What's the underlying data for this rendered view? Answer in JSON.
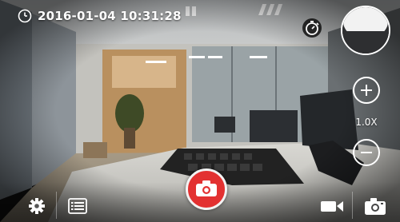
{
  "camera": {
    "timestamp": "2016-01-04 10:31:28",
    "zoom_level": "1.0X"
  },
  "controls": {
    "timer_icon": "self-timer-icon",
    "preview_icon": "last-capture-thumbnail",
    "zoom_in_icon": "plus-icon",
    "zoom_out_icon": "minus-icon",
    "settings_icon": "gear-icon",
    "list_icon": "list-icon",
    "shutter_icon": "camera-icon",
    "video_mode_icon": "video-camera-icon",
    "photo_mode_icon": "camera-icon"
  },
  "colors": {
    "shutter_red": "#e33131",
    "overlay_text": "#ffffff"
  }
}
